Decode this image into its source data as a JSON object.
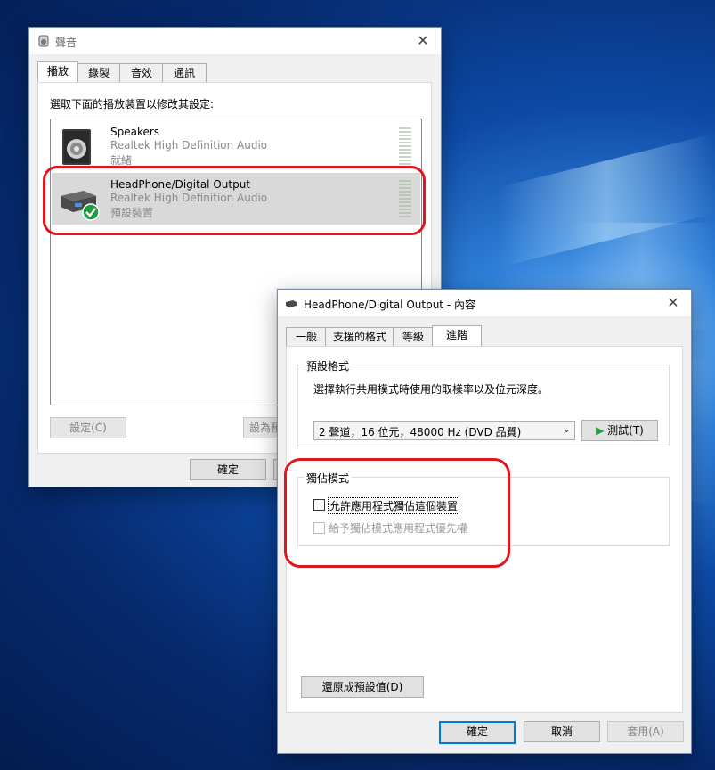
{
  "sound_dialog": {
    "title": "聲音",
    "tabs": [
      "播放",
      "錄製",
      "音效",
      "通訊"
    ],
    "instruction": "選取下面的播放裝置以修改其設定:",
    "devices": [
      {
        "name": "Speakers",
        "driver": "Realtek High Definition Audio",
        "status": "就緒"
      },
      {
        "name": "HeadPhone/Digital Output",
        "driver": "Realtek High Definition Audio",
        "status": "預設裝置"
      }
    ],
    "configure_button": "設定(C)",
    "set_default_button": "設為預",
    "ok_button": "確定",
    "close_glyph": "✕"
  },
  "properties_dialog": {
    "title": "HeadPhone/Digital Output - 內容",
    "tabs": [
      "一般",
      "支援的格式",
      "等級",
      "進階"
    ],
    "default_format": {
      "group_title": "預設格式",
      "description": "選擇執行共用模式時使用的取樣率以及位元深度。",
      "selected_format": "2 聲道，16 位元，48000 Hz (DVD 品質)",
      "test_button": "測試(T)"
    },
    "exclusive_mode": {
      "group_title": "獨佔模式",
      "allow_exclusive": {
        "label": "允許應用程式獨佔這個裝置",
        "checked": false
      },
      "give_priority": {
        "label": "給予獨佔模式應用程式優先權",
        "checked": false,
        "disabled": true
      }
    },
    "restore_defaults_button": "還原成預設值(D)",
    "ok_button": "確定",
    "cancel_button": "取消",
    "apply_button": "套用(A)",
    "close_glyph": "✕"
  },
  "highlight_color": "#e0161d",
  "accent_color": "#0078d7"
}
